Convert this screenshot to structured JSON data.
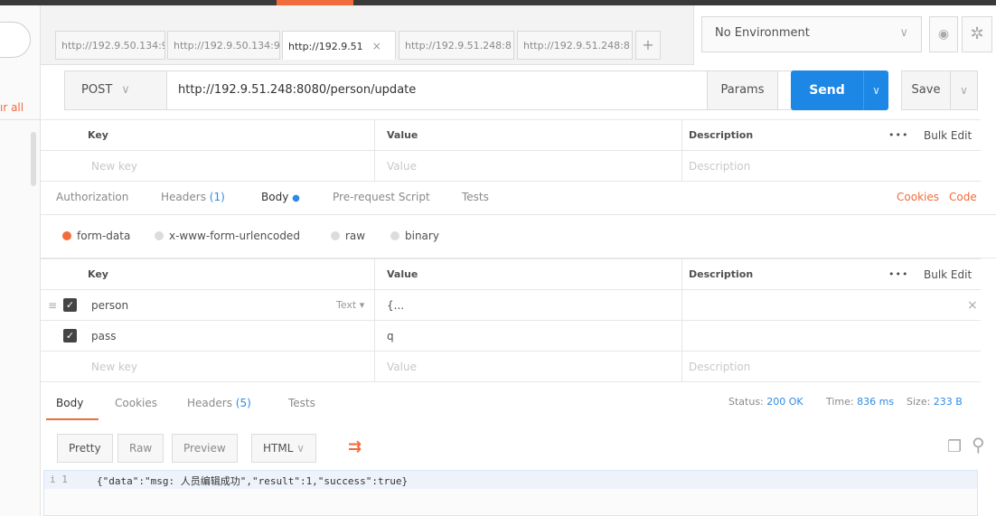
{
  "sidebar": {
    "clear_all": "ır all"
  },
  "tabs": [
    {
      "label": "http://192.9.50.134:9"
    },
    {
      "label": "http://192.9.50.134:9"
    },
    {
      "label": "http://192.9.51",
      "close": "×"
    },
    {
      "label": "http://192.9.51.248:8"
    },
    {
      "label": "http://192.9.51.248:8"
    }
  ],
  "add_tab": "+",
  "environment": {
    "selected": "No Environment",
    "chevron": "∨"
  },
  "request": {
    "method": "POST",
    "url": "http://192.9.51.248:8080/person/update",
    "params_label": "Params",
    "send_label": "Send",
    "save_label": "Save"
  },
  "params_table": {
    "headers": {
      "key": "Key",
      "value": "Value",
      "description": "Description",
      "dots": "•••",
      "bulk": "Bulk Edit"
    },
    "placeholders": {
      "key": "New key",
      "value": "Value",
      "description": "Description"
    }
  },
  "request_tabs": {
    "authorization": "Authorization",
    "headers": "Headers",
    "headers_count": "(1)",
    "body": "Body",
    "body_dot": "●",
    "prerequest": "Pre-request Script",
    "tests": "Tests",
    "cookies": "Cookies",
    "code": "Code"
  },
  "body_types": [
    "form-data",
    "x-www-form-urlencoded",
    "raw",
    "binary"
  ],
  "form_table": {
    "headers": {
      "key": "Key",
      "value": "Value",
      "description": "Description",
      "dots": "•••",
      "bulk": "Bulk Edit"
    },
    "rows": [
      {
        "key": "person",
        "type": "Text ▾",
        "value": "{...",
        "remove": "×"
      },
      {
        "key": "pass",
        "value": "q"
      }
    ],
    "placeholders": {
      "key": "New key",
      "value": "Value",
      "description": "Description"
    }
  },
  "response": {
    "tabs": {
      "body": "Body",
      "cookies": "Cookies",
      "headers": "Headers",
      "headers_count": "(5)",
      "tests": "Tests"
    },
    "status_label": "Status:",
    "status_value": "200 OK",
    "time_label": "Time:",
    "time_value": "836 ms",
    "size_label": "Size:",
    "size_value": "233 B",
    "views": {
      "pretty": "Pretty",
      "raw": "Raw",
      "preview": "Preview",
      "format": "HTML"
    },
    "gutter": "i 1",
    "body_text": "{\"data\":\"msg: 人员编辑成功\",\"result\":1,\"success\":true}"
  },
  "colors": {
    "accent": "#f26b3a",
    "send": "#1c87e5",
    "link": "#2e8ae6"
  }
}
